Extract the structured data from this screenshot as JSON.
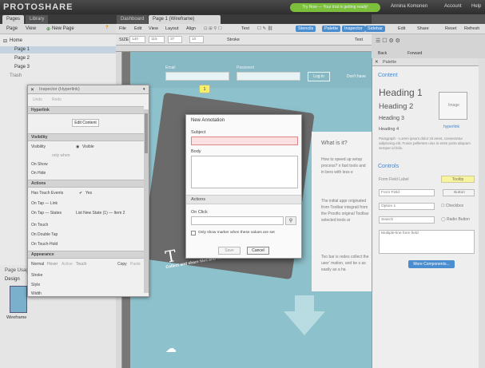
{
  "app": {
    "logo": "PROTOSHARE",
    "notice": "Try Now — Your trial is getting ready!",
    "user": "Annina Komonen",
    "account": "Account",
    "help": "Help"
  },
  "left_tabs": [
    "Pages",
    "Library"
  ],
  "left_toolbar": {
    "page": "Page",
    "view": "View",
    "new_page": "New Page"
  },
  "tree": [
    {
      "label": "Home"
    },
    {
      "label": "Page 1"
    },
    {
      "label": "Page 2"
    },
    {
      "label": "Page 3"
    },
    {
      "label": "Trash"
    }
  ],
  "left_bottom": {
    "title": "Page Usage",
    "design": "Design",
    "thumb_label": "Wireframe"
  },
  "center_tabs": [
    "Dashboard",
    "Page 1 (Wireframe)"
  ],
  "menu": [
    "File",
    "Edit",
    "View",
    "Layout",
    "Align"
  ],
  "toolbar_right": [
    "Text",
    "Stencils",
    "Palette",
    "Inspector",
    "Sidebar"
  ],
  "share": [
    "Edit",
    "Share",
    "Reset",
    "Refresh"
  ],
  "toolbar2": {
    "size_label": "SIZE",
    "w": "140",
    "h": "115",
    "x": "37",
    "y": "10",
    "stroke": "Stroke",
    "text": "Text"
  },
  "canvas": {
    "email": "Email",
    "password": "Password",
    "login": "Log in",
    "dont": "Don't have",
    "heading": "What is it?",
    "para1": "How to speed up setup process? n fast tools and in bers with less e",
    "para2": "The initial appr originated from Toolbar integrati from the Proofio original Toolbar selected tools ar",
    "para3": "Too bar is redes collect the user' mation, and be s as easily as a ha",
    "card_text": "Collect and share files and Toolbar"
  },
  "inspector": {
    "title": "Inspector (Hyperlink)",
    "undo": "Undo",
    "redo": "Redo",
    "hyperlink": "Hyperlink",
    "edit_content": "Edit Content",
    "visibility": "Visibility",
    "vis_label": "Visibility",
    "vis_value": "Visible",
    "only_when": "only when",
    "on_show": "On Show",
    "on_hide": "On Hide",
    "actions": "Actions",
    "has_touch": "Has Touch Events",
    "yes": "Yes",
    "on_tap": "On Tap — Link",
    "on_tap_states": "On Tap — States",
    "states_val": "List New State (1) — Item 2",
    "on_touch": "On Touch",
    "on_double": "On Double Tap",
    "on_touch_hold": "On Touch-Hold",
    "appearance": "Appearance",
    "modes": [
      "Normal",
      "Hover",
      "Active",
      "Touch"
    ],
    "copy": "Copy",
    "paste": "Paste",
    "stroke": "Stroke",
    "style": "Style",
    "width": "Width"
  },
  "annotation": {
    "title": "New Annotation",
    "subject": "Subject",
    "body": "Body",
    "actions": "Actions",
    "on_click": "On Click",
    "checkbox": "Only show marker when these values are set",
    "save": "Save",
    "cancel": "Cancel"
  },
  "right": {
    "back": "Back",
    "forward": "Forward"
  },
  "palette": {
    "title": "Palette",
    "content": "Content",
    "h1": "Heading 1",
    "h2": "Heading 2",
    "h3": "Heading 3",
    "h4": "Heading 4",
    "image": "Image",
    "hyperlink": "hyperlink",
    "paragraph": "Paragraph - Lorem ipsum dolor sit amet, consectetur adipiscing elit. Fusce pellentes ulus in enim porta aliquam semper id felis.",
    "controls": "Controls",
    "field_label": "Form Field Label",
    "tooltip": "Tooltip",
    "form_field": "Form Field",
    "button": "Button",
    "option": "Option 1",
    "checkbox": "Checkbox",
    "search": "Search",
    "radio": "Radio Button",
    "multiline": "Multiple-line form field",
    "more": "More Components..."
  },
  "marker_number": "1"
}
